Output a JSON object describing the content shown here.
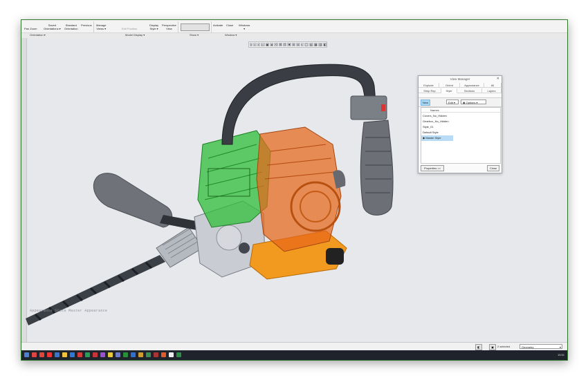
{
  "ribbon": {
    "pan_zoom": "Pan Zoom",
    "saved_orientations": "Saved\nOrientations ▾",
    "standard_orientation": "Standard\nOrientation",
    "previous": "Previous",
    "manage_views": "Manage\nViews ▾",
    "edit_position": "Edit Position",
    "display_style": "Display\nStyle ▾",
    "perspective_view": "Perspective\nView",
    "activate": "Activate",
    "close": "Close",
    "windows": "Windows\n▾",
    "groups": {
      "orientation": "Orientation ▾",
      "model_display": "Model Display ▾",
      "show": "Show ▾",
      "window": "Window ▾"
    }
  },
  "view_toolbar": [
    "⌕",
    "⌕",
    "⌕",
    "▭",
    "▣",
    "◈",
    "⟲",
    "⊞",
    "⊡",
    "✱",
    "⊕",
    "⊗",
    "◐",
    "▢",
    "▤",
    "▦",
    "▥",
    "◧"
  ],
  "viewport": {
    "appearance_state": "Appearance State Master Appearance"
  },
  "view_manager": {
    "title": "View Manager",
    "tabs_row1": [
      "Explode",
      "Orient",
      "Appearance",
      "All"
    ],
    "tabs_row2": [
      "Simp Rep",
      "Style",
      "Sections",
      "Layers"
    ],
    "active_tab": "Style",
    "new_label": "New",
    "edit_label": "Edit ▾",
    "options_label": "Options ▾",
    "list_header": "Names",
    "items": [
      "Covers_No_Hidden",
      "Gearbox_No_Hidden",
      "Style_01",
      "Default Style",
      "Master Style"
    ],
    "active_item": "Master Style",
    "properties_label": "Properties >>",
    "close_label": "Close"
  },
  "status_bar": {
    "selected": "2 selected",
    "filter": "Geometry"
  },
  "taskbar": {
    "time": "15:51",
    "icons": [
      "#4d7fd3",
      "#d44",
      "#e0473a",
      "#e33",
      "#3b76c9",
      "#f2c23b",
      "#2e78d6",
      "#d53a3a",
      "#2a9d55",
      "#c9343a",
      "#9b4fd1",
      "#e7c83b",
      "#6a7bd0",
      "#2a8f3a",
      "#2f6fd2",
      "#cf9c31",
      "#3d8f52",
      "#aa3333",
      "#e05a2b",
      "#ededed",
      "#2b8f43"
    ]
  },
  "colors": {
    "frame_border": "#2f7a2f",
    "viewport_bg": "#e7e8ec",
    "selection_highlight": "#b8dcf5",
    "engine_green": "#2fbf3a",
    "engine_orange": "#e8671a"
  }
}
